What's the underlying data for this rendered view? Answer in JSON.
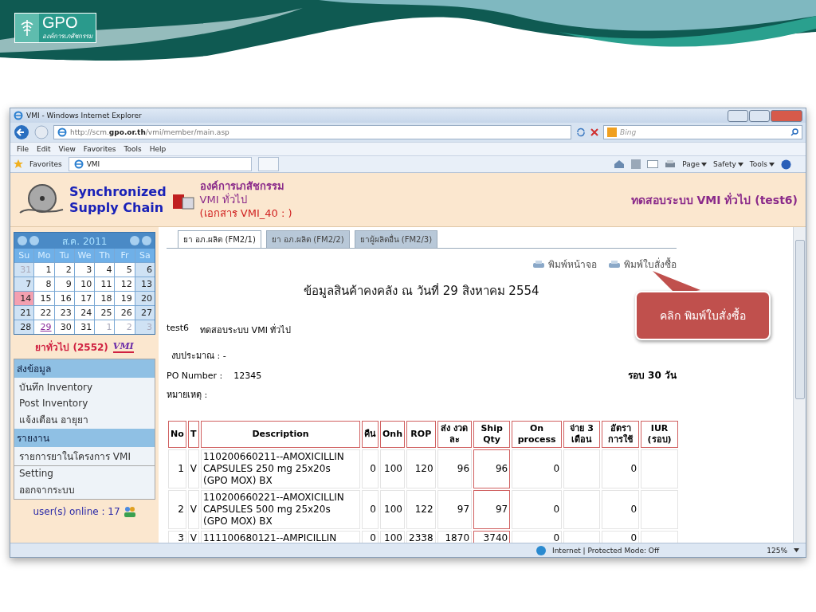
{
  "slide": {
    "logo": {
      "name": "GPO",
      "subtitle": "องค์การเภสัชกรรม"
    }
  },
  "browser": {
    "title": "VMI - Windows Internet Explorer",
    "address": {
      "prefix": "http://scm.",
      "domain": "gpo.or.th",
      "path": "/vmi/member/main.asp"
    },
    "search": {
      "placeholder": "Bing"
    },
    "menu": [
      "File",
      "Edit",
      "View",
      "Favorites",
      "Tools",
      "Help"
    ],
    "favorites": "Favorites",
    "tab": "VMI",
    "commands": [
      "Page",
      "Safety",
      "Tools"
    ]
  },
  "site": {
    "brand": [
      "Synchronized",
      "Supply Chain"
    ],
    "org": "องค์การเภสัชกรรม",
    "program": "VMI ทั่วไป",
    "document": "(เอกสาร VMI_40 : )",
    "user": "ทดสอบระบบ VMI ทั่วไป (test6)"
  },
  "calendar": {
    "month": "ส.ค. 2011",
    "weekdays": [
      "Su",
      "Mo",
      "Tu",
      "We",
      "Th",
      "Fr",
      "Sa"
    ],
    "weeks": [
      [
        {
          "label": "31",
          "other_month": true,
          "today": false,
          "link": false
        },
        {
          "label": "1",
          "other_month": false,
          "today": false,
          "link": false
        },
        {
          "label": "2",
          "other_month": false,
          "today": false,
          "link": false
        },
        {
          "label": "3",
          "other_month": false,
          "today": false,
          "link": false
        },
        {
          "label": "4",
          "other_month": false,
          "today": false,
          "link": false
        },
        {
          "label": "5",
          "other_month": false,
          "today": false,
          "link": false
        },
        {
          "label": "6",
          "other_month": false,
          "today": false,
          "link": false
        }
      ],
      [
        {
          "label": "7",
          "other_month": false,
          "today": false,
          "link": false
        },
        {
          "label": "8",
          "other_month": false,
          "today": false,
          "link": false
        },
        {
          "label": "9",
          "other_month": false,
          "today": false,
          "link": false
        },
        {
          "label": "10",
          "other_month": false,
          "today": false,
          "link": false
        },
        {
          "label": "11",
          "other_month": false,
          "today": false,
          "link": false
        },
        {
          "label": "12",
          "other_month": false,
          "today": false,
          "link": false
        },
        {
          "label": "13",
          "other_month": false,
          "today": false,
          "link": false
        }
      ],
      [
        {
          "label": "14",
          "other_month": false,
          "today": true,
          "link": false
        },
        {
          "label": "15",
          "other_month": false,
          "today": false,
          "link": false
        },
        {
          "label": "16",
          "other_month": false,
          "today": false,
          "link": false
        },
        {
          "label": "17",
          "other_month": false,
          "today": false,
          "link": false
        },
        {
          "label": "18",
          "other_month": false,
          "today": false,
          "link": false
        },
        {
          "label": "19",
          "other_month": false,
          "today": false,
          "link": false
        },
        {
          "label": "20",
          "other_month": false,
          "today": false,
          "link": false
        }
      ],
      [
        {
          "label": "21",
          "other_month": false,
          "today": false,
          "link": false
        },
        {
          "label": "22",
          "other_month": false,
          "today": false,
          "link": false
        },
        {
          "label": "23",
          "other_month": false,
          "today": false,
          "link": false
        },
        {
          "label": "24",
          "other_month": false,
          "today": false,
          "link": false
        },
        {
          "label": "25",
          "other_month": false,
          "today": false,
          "link": false
        },
        {
          "label": "26",
          "other_month": false,
          "today": false,
          "link": false
        },
        {
          "label": "27",
          "other_month": false,
          "today": false,
          "link": false
        }
      ],
      [
        {
          "label": "28",
          "other_month": false,
          "today": false,
          "link": false
        },
        {
          "label": "29",
          "other_month": false,
          "today": false,
          "link": true
        },
        {
          "label": "30",
          "other_month": false,
          "today": false,
          "link": false
        },
        {
          "label": "31",
          "other_month": false,
          "today": false,
          "link": false
        },
        {
          "label": "1",
          "other_month": true,
          "today": false,
          "link": false
        },
        {
          "label": "2",
          "other_month": true,
          "today": false,
          "link": false
        },
        {
          "label": "3",
          "other_month": true,
          "today": false,
          "link": false
        }
      ]
    ]
  },
  "program_label": "ยาทั่วไป (2552)",
  "vmi_badge": "VMI",
  "menu_groups": [
    {
      "title": "ส่งข้อมูล",
      "items": [
        "บันทึก Inventory",
        "Post Inventory",
        "แจ้งเตือน อายุยา"
      ]
    },
    {
      "title": "รายงาน",
      "items": [
        "รายการยาในโครงการ VMI"
      ]
    },
    {
      "items": [
        "Setting",
        "ออกจากระบบ"
      ]
    }
  ],
  "online": "user(s) online : 17",
  "tabs": [
    {
      "label": "ยา อภ.ผลิต (FM2/1)",
      "selected": true
    },
    {
      "label": "ยา อภ.ผลิต (FM2/2)",
      "selected": false
    },
    {
      "label": "ยาผู้ผลิตอื่น (FM2/3)",
      "selected": false
    }
  ],
  "print_links": [
    "พิมพ์หน้าจอ",
    "พิมพ์ใบสั่งซื้อ"
  ],
  "heading": "ข้อมูลสินค้าคงคลัง ณ วันที่  29 สิงหาคม 2554",
  "info": {
    "user_code": "test6",
    "user_name": "ทดสอบระบบ VMI ทั่วไป",
    "budget": "งบประมาณ : -",
    "po_label": "PO Number :",
    "po_number": "12345",
    "cycle": "รอบ 30 วัน",
    "note": "หมายเหตุ :"
  },
  "callout": "คลิก พิมพ์ใบสั่งซื้อ",
  "table": {
    "columns": [
      "No",
      "T",
      "Description",
      "คืน",
      "Onh",
      "ROP",
      "ส่ง งวดละ",
      "Ship Qty",
      "On process",
      "จ่าย 3 เดือน",
      "อัตรา การใช้",
      "IUR (รอบ)"
    ],
    "rows": [
      [
        "1",
        "V",
        "110200660211--AMOXICILLIN CAPSULES 250 mg 25x20s (GPO MOX)  BX",
        "0",
        "100",
        "120",
        "96",
        "96",
        "0",
        "",
        "0",
        ""
      ],
      [
        "2",
        "V",
        "110200660221--AMOXICILLIN CAPSULES 500 mg 25x20s (GPO MOX)  BX",
        "0",
        "100",
        "122",
        "97",
        "97",
        "0",
        "",
        "0",
        ""
      ],
      [
        "3",
        "V",
        "111100680121--AMPICILLIN",
        "0",
        "100",
        "2338",
        "1870",
        "3740",
        "0",
        "",
        "0",
        ""
      ]
    ]
  },
  "status_bar": {
    "zone": "Internet | Protected Mode: Off",
    "zoom": "125%"
  }
}
